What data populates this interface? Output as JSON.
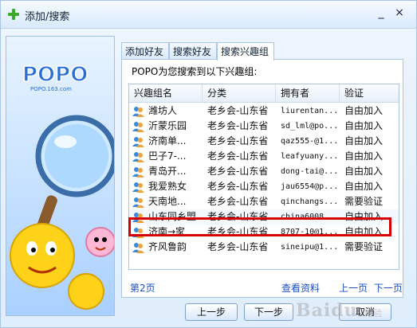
{
  "window": {
    "title": "添加/搜索",
    "minimize_label": "_",
    "close_label": "×",
    "colors": {
      "accent_green": "#3aaa2a",
      "link": "#1b4fbf",
      "highlight_red": "#d70000"
    }
  },
  "sidebar_art": {
    "logo_text": "POPO",
    "logo_sub": "POPO.163.com"
  },
  "tabs": [
    {
      "label": "添加好友",
      "active": false
    },
    {
      "label": "搜索好友",
      "active": false
    },
    {
      "label": "搜索兴趣组",
      "active": true
    }
  ],
  "panel": {
    "intro": "POPO为您搜索到以下兴趣组:",
    "columns": [
      "兴趣组名",
      "分类",
      "拥有者",
      "验证"
    ],
    "rows": [
      {
        "name": "潍坊人",
        "category": "老乡会-山东省",
        "owner": "liurentan...",
        "verify": "自由加入",
        "selected": false
      },
      {
        "name": "沂蒙乐园",
        "category": "老乡会-山东省",
        "owner": "sd_lml@po...",
        "verify": "自由加入",
        "selected": false
      },
      {
        "name": "济南单...",
        "category": "老乡会-山东省",
        "owner": "qaz555-@1...",
        "verify": "自由加入",
        "selected": false
      },
      {
        "name": "巴子7-...",
        "category": "老乡会-山东省",
        "owner": "leafyuany...",
        "verify": "自由加入",
        "selected": false
      },
      {
        "name": "青岛开...",
        "category": "老乡会-山东省",
        "owner": "dong-tai@...",
        "verify": "自由加入",
        "selected": false
      },
      {
        "name": "我爱熟女",
        "category": "老乡会-山东省",
        "owner": "jau6554@p...",
        "verify": "自由加入",
        "selected": false
      },
      {
        "name": "天南地...",
        "category": "老乡会-山东省",
        "owner": "qinchangs...",
        "verify": "需要验证",
        "selected": false
      },
      {
        "name": "山东同乡盟",
        "category": "老乡会-山东省",
        "owner": "china6008...",
        "verify": "自由加入",
        "selected": true
      },
      {
        "name": "济南→家",
        "category": "老乡会-山东省",
        "owner": "8707-10@1...",
        "verify": "自由加入",
        "selected": false
      },
      {
        "name": "齐风鲁韵",
        "category": "老乡会-山东省",
        "owner": "sineipu@1...",
        "verify": "需要验证",
        "selected": false
      }
    ],
    "page_label": "第2页",
    "view_profile_label": "查看资料",
    "prev_page_label": "上一页",
    "next_page_label": "下一页"
  },
  "buttons": {
    "prev": "上一步",
    "next": "下一步",
    "cancel": "取消"
  },
  "watermark": {
    "text": "Baidu",
    "sub": "经验"
  }
}
